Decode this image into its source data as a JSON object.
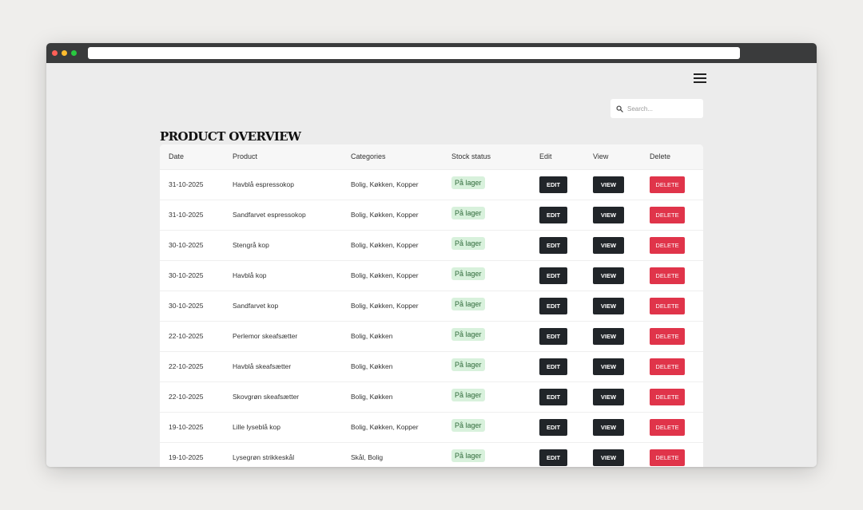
{
  "browser": {
    "url": ""
  },
  "page": {
    "title": "PRODUCT OVERVIEW"
  },
  "search": {
    "placeholder": "Search..."
  },
  "table": {
    "headers": [
      "Date",
      "Product",
      "Categories",
      "Stock status",
      "Edit",
      "View",
      "Delete"
    ],
    "button_labels": {
      "edit": "EDIT",
      "view": "VIEW",
      "delete": "DELETE"
    },
    "rows": [
      {
        "date": "31-10-2025",
        "product": "Havblå espressokop",
        "categories": "Bolig, Køkken, Kopper",
        "stock": "På lager"
      },
      {
        "date": "31-10-2025",
        "product": "Sandfarvet espressokop",
        "categories": "Bolig, Køkken, Kopper",
        "stock": "På lager"
      },
      {
        "date": "30-10-2025",
        "product": "Stengrå kop",
        "categories": "Bolig, Køkken, Kopper",
        "stock": "På lager"
      },
      {
        "date": "30-10-2025",
        "product": "Havblå kop",
        "categories": "Bolig, Køkken, Kopper",
        "stock": "På lager"
      },
      {
        "date": "30-10-2025",
        "product": "Sandfarvet kop",
        "categories": "Bolig, Køkken, Kopper",
        "stock": "På lager"
      },
      {
        "date": "22-10-2025",
        "product": "Perlemor skeafsætter",
        "categories": "Bolig, Køkken",
        "stock": "På lager"
      },
      {
        "date": "22-10-2025",
        "product": "Havblå skeafsætter",
        "categories": "Bolig, Køkken",
        "stock": "På lager"
      },
      {
        "date": "22-10-2025",
        "product": "Skovgrøn skeafsætter",
        "categories": "Bolig, Køkken",
        "stock": "På lager"
      },
      {
        "date": "19-10-2025",
        "product": "Lille lyseblå kop",
        "categories": "Bolig, Køkken, Kopper",
        "stock": "På lager"
      },
      {
        "date": "19-10-2025",
        "product": "Lysegrøn strikkeskål",
        "categories": "Skål, Bolig",
        "stock": "På lager"
      }
    ]
  },
  "colors": {
    "dark_button": "#212529",
    "delete_button": "#e0344a",
    "stock_badge_bg": "#d8f1dc",
    "stock_badge_text": "#2f6a3a"
  },
  "icons": {
    "menu": "hamburger-menu-icon",
    "search": "search-icon"
  }
}
